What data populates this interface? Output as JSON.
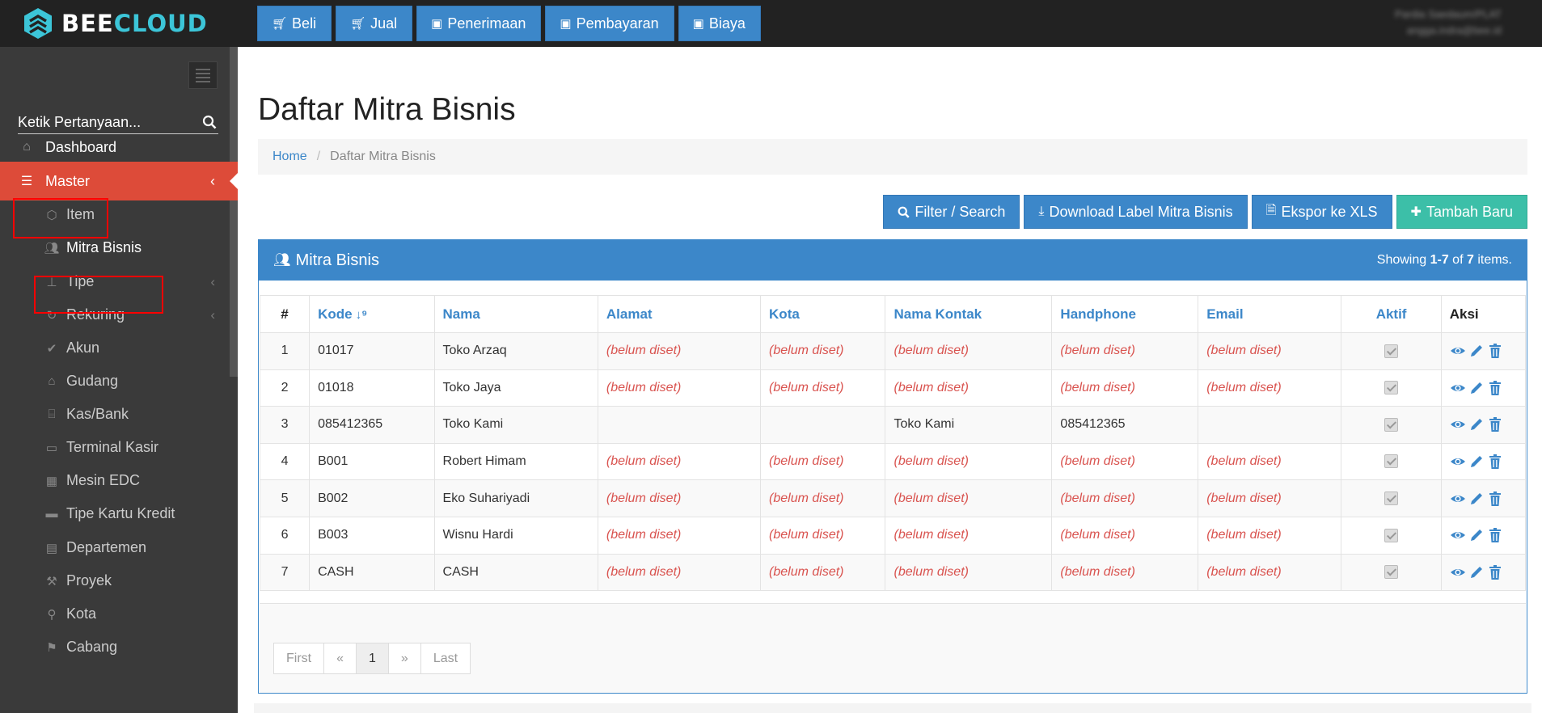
{
  "brand": {
    "part1": "BEE",
    "part2": "CLOUD"
  },
  "topnav": [
    {
      "label": "Beli",
      "icon": "cart-icon"
    },
    {
      "label": "Jual",
      "icon": "cart-icon"
    },
    {
      "label": "Penerimaan",
      "icon": "money-icon"
    },
    {
      "label": "Pembayaran",
      "icon": "money-icon"
    },
    {
      "label": "Biaya",
      "icon": "money-icon"
    }
  ],
  "user": {
    "name": "Pardia Saedaum/PLAT",
    "email": "angga.indra@bee.id"
  },
  "sidebar": {
    "search_placeholder": "Ketik Pertanyaan...",
    "dashboard": "Dashboard",
    "master": "Master",
    "items": [
      {
        "label": "Item",
        "icon": "cube-icon"
      },
      {
        "label": "Mitra Bisnis",
        "icon": "users-icon"
      },
      {
        "label": "Tipe",
        "icon": "sitemap-icon"
      },
      {
        "label": "Rekuring",
        "icon": "refresh-icon"
      },
      {
        "label": "Akun",
        "icon": "check-icon"
      },
      {
        "label": "Gudang",
        "icon": "home-icon"
      },
      {
        "label": "Kas/Bank",
        "icon": "bank-icon"
      },
      {
        "label": "Terminal Kasir",
        "icon": "desktop-icon"
      },
      {
        "label": "Mesin EDC",
        "icon": "calculator-icon"
      },
      {
        "label": "Tipe Kartu Kredit",
        "icon": "credit-card-icon"
      },
      {
        "label": "Departemen",
        "icon": "building-icon"
      },
      {
        "label": "Proyek",
        "icon": "gavel-icon"
      },
      {
        "label": "Kota",
        "icon": "map-marker-icon"
      },
      {
        "label": "Cabang",
        "icon": "flag-icon"
      }
    ]
  },
  "page": {
    "title": "Daftar Mitra Bisnis",
    "breadcrumb_home": "Home",
    "breadcrumb_sep": "/",
    "breadcrumb_current": "Daftar Mitra Bisnis"
  },
  "actions": {
    "filter": "Filter / Search",
    "download": "Download Label Mitra Bisnis",
    "export": "Ekspor ke XLS",
    "add": "Tambah Baru"
  },
  "panel": {
    "title": "Mitra Bisnis",
    "summary_prefix": "Showing ",
    "summary_range": "1-7",
    "summary_of": " of ",
    "summary_total": "7",
    "summary_suffix": " items."
  },
  "table": {
    "headers": [
      "#",
      "Kode",
      "Nama",
      "Alamat",
      "Kota",
      "Nama Kontak",
      "Handphone",
      "Email",
      "Aktif",
      "Aksi"
    ],
    "unset": "(belum diset)",
    "rows": [
      {
        "no": "1",
        "kode": "01017",
        "nama": "Toko Arzaq",
        "alamat": "(belum diset)",
        "kota": "(belum diset)",
        "kontak": "(belum diset)",
        "hp": "(belum diset)",
        "email": "(belum diset)"
      },
      {
        "no": "2",
        "kode": "01018",
        "nama": "Toko Jaya",
        "alamat": "(belum diset)",
        "kota": "(belum diset)",
        "kontak": "(belum diset)",
        "hp": "(belum diset)",
        "email": "(belum diset)"
      },
      {
        "no": "3",
        "kode": "085412365",
        "nama": "Toko Kami",
        "alamat": "",
        "kota": "",
        "kontak": "Toko Kami",
        "hp": "085412365",
        "email": ""
      },
      {
        "no": "4",
        "kode": "B001",
        "nama": "Robert Himam",
        "alamat": "(belum diset)",
        "kota": "(belum diset)",
        "kontak": "(belum diset)",
        "hp": "(belum diset)",
        "email": "(belum diset)"
      },
      {
        "no": "5",
        "kode": "B002",
        "nama": "Eko Suhariyadi",
        "alamat": "(belum diset)",
        "kota": "(belum diset)",
        "kontak": "(belum diset)",
        "hp": "(belum diset)",
        "email": "(belum diset)"
      },
      {
        "no": "6",
        "kode": "B003",
        "nama": "Wisnu Hardi",
        "alamat": "(belum diset)",
        "kota": "(belum diset)",
        "kontak": "(belum diset)",
        "hp": "(belum diset)",
        "email": "(belum diset)"
      },
      {
        "no": "7",
        "kode": "CASH",
        "nama": "CASH",
        "alamat": "(belum diset)",
        "kota": "(belum diset)",
        "kontak": "(belum diset)",
        "hp": "(belum diset)",
        "email": "(belum diset)"
      }
    ]
  },
  "pager": {
    "first": "First",
    "prev": "«",
    "current": "1",
    "next": "»",
    "last": "Last"
  },
  "colors": {
    "primary": "#3c87c9",
    "danger": "#dd4b39",
    "success": "#3cbfa8",
    "accent": "#3cc5d8"
  }
}
